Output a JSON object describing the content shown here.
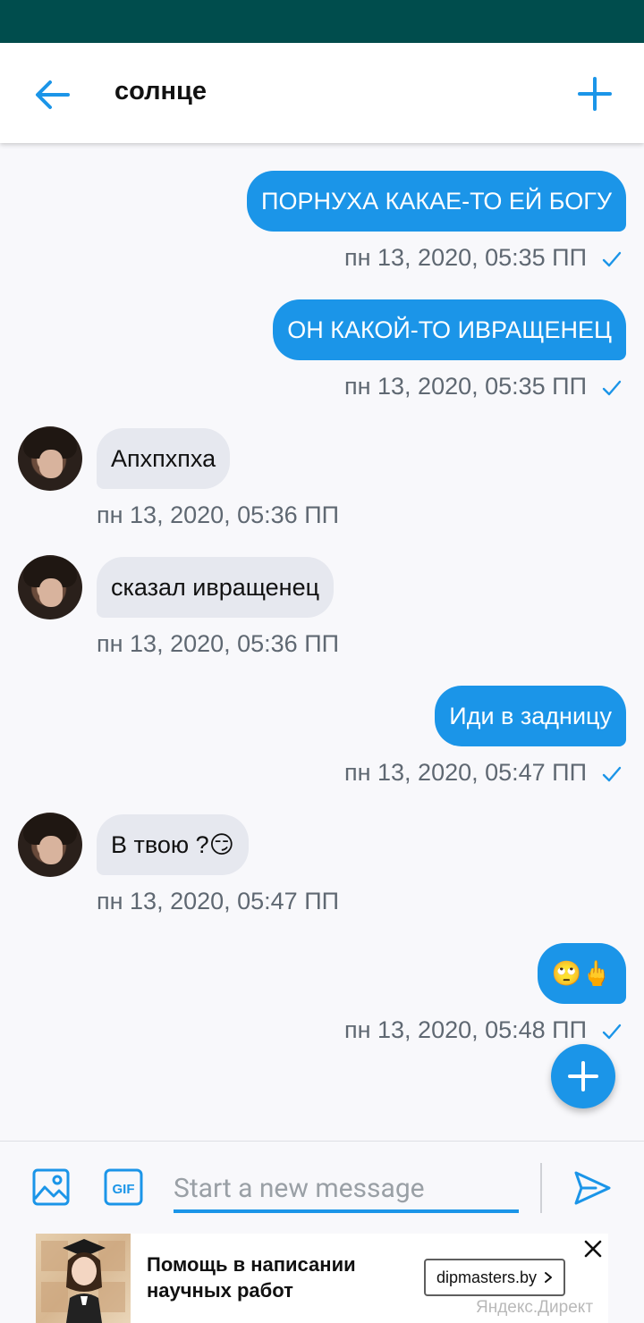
{
  "header": {
    "back_icon": "arrow-left-icon",
    "title": "солнце",
    "add_icon": "plus-icon"
  },
  "messages": [
    {
      "direction": "out",
      "text": "ПОРНУХА КАКАЕ-ТО ЕЙ БОГУ",
      "time": "пн 13, 2020, 05:35 ПП",
      "read": true
    },
    {
      "direction": "out",
      "text": "ОН КАКОЙ-ТО ИВРАЩЕНЕЦ",
      "time": "пн 13, 2020, 05:35 ПП",
      "read": true
    },
    {
      "direction": "in",
      "text": "Апхпхпха",
      "time": "пн 13, 2020, 05:36 ПП"
    },
    {
      "direction": "in",
      "text": "сказал ивращенец",
      "time": "пн 13, 2020, 05:36 ПП"
    },
    {
      "direction": "out",
      "text": "Иди в задницу",
      "time": "пн 13, 2020, 05:47 ПП",
      "read": true
    },
    {
      "direction": "in",
      "text": "В твою ?😏",
      "time": "пн 13, 2020, 05:47 ПП"
    },
    {
      "direction": "out",
      "text": "🙄🖕",
      "time": "пн 13, 2020, 05:48 ПП",
      "read": true
    }
  ],
  "composer": {
    "placeholder": "Start a new message",
    "value": "",
    "image_icon": "image-icon",
    "gif_label": "GIF",
    "send_icon": "send-icon"
  },
  "fab": {
    "icon": "plus-icon"
  },
  "ad": {
    "text": "Помощь в написании научных работ",
    "button_label": "dipmasters.by",
    "source": "Яндекс.Директ",
    "close_icon": "close-icon"
  },
  "colors": {
    "status_bar": "#004d4d",
    "accent": "#1b95e8",
    "incoming_bubble": "#e6e8ef",
    "background": "#f8f8fb"
  }
}
